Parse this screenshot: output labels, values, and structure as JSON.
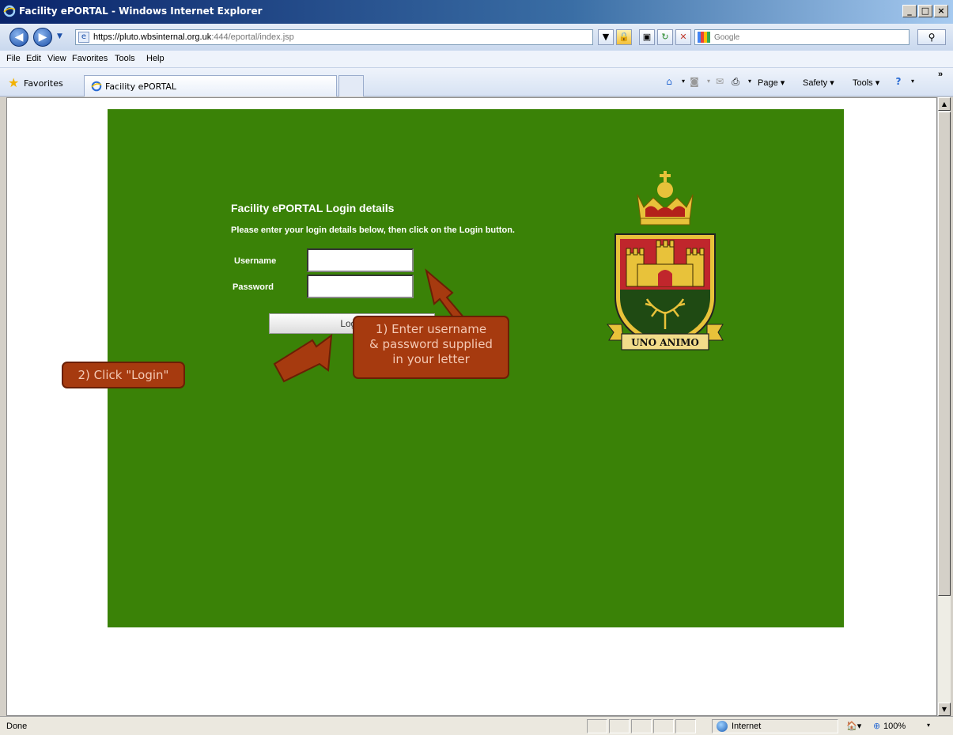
{
  "window": {
    "title": "Facility ePORTAL - Windows Internet Explorer",
    "min": "_",
    "max": "□",
    "close": "×"
  },
  "address": {
    "url_host": "https://pluto.wbsinternal.org.uk",
    "url_path": ":444/eportal/index.jsp",
    "search_placeholder": "Google"
  },
  "menu": [
    "File",
    "Edit",
    "View",
    "Favorites",
    "Tools",
    "Help"
  ],
  "favorites_bar": {
    "favorites_label": "Favorites",
    "tab_label": "Facility ePORTAL"
  },
  "commands": {
    "page": "Page ▾",
    "safety": "Safety ▾",
    "tools": "Tools ▾",
    "overflow": "»"
  },
  "login": {
    "title": "Facility ePORTAL Login details",
    "subtitle": "Please enter your login details below, then click on the Login button.",
    "username_label": "Username",
    "password_label": "Password",
    "username_value": "",
    "password_value": "",
    "button_label": "Login"
  },
  "crest": {
    "motto": "UNO ANIMO"
  },
  "callouts": {
    "step1": [
      "1) Enter username",
      "& password supplied",
      "in your letter"
    ],
    "step2": "2) Click \"Login\""
  },
  "status": {
    "text": "Done",
    "zone": "Internet",
    "zoom": "100%"
  },
  "colors": {
    "panel_green": "#3a8207",
    "callout_fill": "#a63a0f",
    "callout_border": "#6a1f05"
  }
}
